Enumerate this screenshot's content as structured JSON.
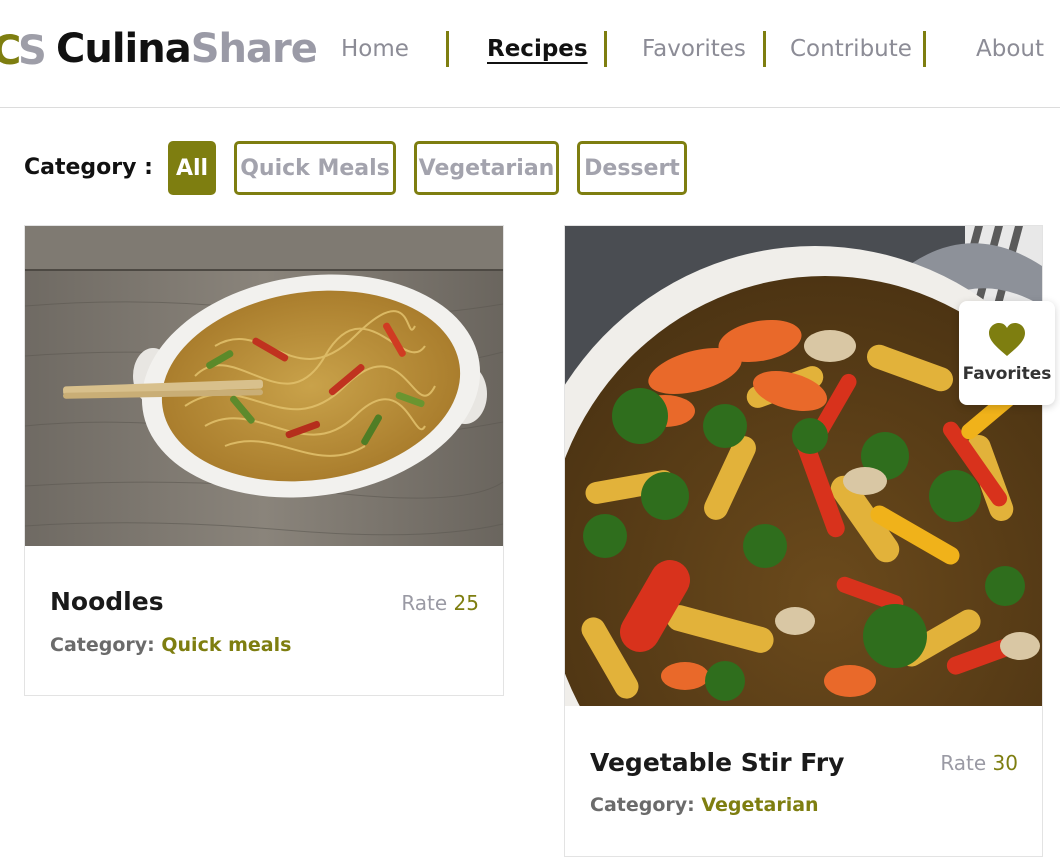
{
  "brand": {
    "mark_left": "C",
    "mark_right": "S",
    "name_part1": "Culina",
    "name_part2": "Share"
  },
  "nav": {
    "items": [
      {
        "label": "Home",
        "active": false
      },
      {
        "label": "Recipes",
        "active": true
      },
      {
        "label": "Favorites",
        "active": false
      },
      {
        "label": "Contribute",
        "active": false
      },
      {
        "label": "About",
        "active": false
      }
    ]
  },
  "filter": {
    "label": "Category :",
    "chips": [
      {
        "label": "All",
        "active": true
      },
      {
        "label": "Quick Meals",
        "active": false
      },
      {
        "label": "Vegetarian",
        "active": false
      },
      {
        "label": "Dessert",
        "active": false
      }
    ]
  },
  "recipes": [
    {
      "title": "Noodles",
      "rate_label": "Rate",
      "rate": "25",
      "category_label": "Category:",
      "category": "Quick meals"
    },
    {
      "title": "Vegetable Stir Fry",
      "rate_label": "Rate",
      "rate": "30",
      "category_label": "Category:",
      "category": "Vegetarian",
      "favorite_label": "Favorites"
    }
  ],
  "colors": {
    "accent": "#7e7e10",
    "muted_text": "#9a9aa4",
    "dark_text": "#1a1a1a"
  },
  "icons": {
    "favorite": "heart-icon"
  }
}
